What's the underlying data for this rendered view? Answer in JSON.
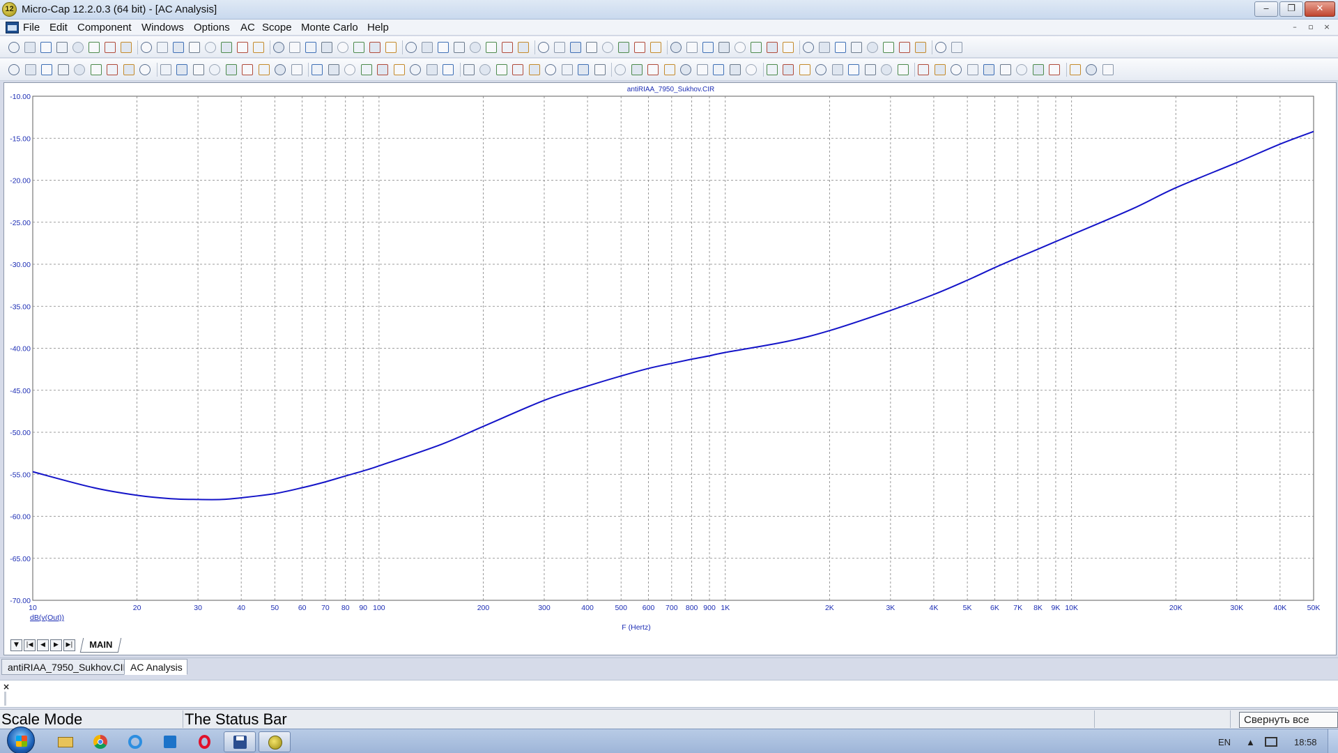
{
  "window": {
    "title": "Micro-Cap 12.2.0.3 (64 bit) - [AC Analysis]",
    "app_icon": "12",
    "buttons": [
      "minimize-icon",
      "restore-icon",
      "close-icon"
    ]
  },
  "menu": {
    "items": [
      "File",
      "Edit",
      "Component",
      "Windows",
      "Options",
      "AC",
      "Scope",
      "Monte Carlo",
      "Help"
    ]
  },
  "plot": {
    "title": "antiRIAA_7950_Sukhov.CIR",
    "ylabel": "dB(v(Out))",
    "xlabel": "F (Hertz)"
  },
  "chart_data": {
    "type": "line",
    "title": "antiRIAA_7950_Sukhov.CIR",
    "xlabel": "F (Hertz)",
    "ylabel": "dB(v(Out))",
    "xscale": "log",
    "xlim": [
      10,
      50000
    ],
    "ylim": [
      -70,
      -10
    ],
    "grid": true,
    "line_color": "#1414c8",
    "x_ticks": [
      "10",
      "20",
      "30",
      "40",
      "50",
      "60",
      "70",
      "80",
      "90",
      "100",
      "200",
      "300",
      "400",
      "500",
      "600",
      "700",
      "800",
      "900",
      "1K",
      "2K",
      "3K",
      "4K",
      "5K",
      "6K",
      "7K",
      "8K",
      "9K",
      "10K",
      "20K",
      "30K",
      "40K",
      "50K"
    ],
    "x_tick_values": [
      10,
      20,
      30,
      40,
      50,
      60,
      70,
      80,
      90,
      100,
      200,
      300,
      400,
      500,
      600,
      700,
      800,
      900,
      1000,
      2000,
      3000,
      4000,
      5000,
      6000,
      7000,
      8000,
      9000,
      10000,
      20000,
      30000,
      40000,
      50000
    ],
    "y_ticks": [
      "-10.00",
      "-15.00",
      "-20.00",
      "-25.00",
      "-30.00",
      "-35.00",
      "-40.00",
      "-45.00",
      "-50.00",
      "-55.00",
      "-60.00",
      "-65.00",
      "-70.00"
    ],
    "y_tick_values": [
      -10,
      -15,
      -20,
      -25,
      -30,
      -35,
      -40,
      -45,
      -50,
      -55,
      -60,
      -65,
      -70
    ],
    "series": [
      {
        "x": [
          10,
          15,
          20,
          25,
          30,
          35,
          40,
          50,
          60,
          70,
          80,
          90,
          100,
          150,
          200,
          300,
          400,
          500,
          600,
          700,
          800,
          900,
          1000,
          1500,
          2000,
          3000,
          4000,
          5000,
          6000,
          7000,
          8000,
          9000,
          10000,
          15000,
          20000,
          30000,
          40000,
          50000
        ],
        "y": [
          -54.7,
          -56.6,
          -57.5,
          -57.9,
          -58.0,
          -58.0,
          -57.8,
          -57.3,
          -56.6,
          -55.9,
          -55.2,
          -54.6,
          -54.0,
          -51.5,
          -49.3,
          -46.2,
          -44.5,
          -43.3,
          -42.4,
          -41.8,
          -41.3,
          -40.9,
          -40.5,
          -39.2,
          -37.9,
          -35.5,
          -33.6,
          -31.9,
          -30.4,
          -29.2,
          -28.2,
          -27.3,
          -26.5,
          -23.4,
          -20.9,
          -17.9,
          -15.7,
          -14.2
        ]
      }
    ]
  },
  "page_tabs": {
    "main": "MAIN",
    "nav": [
      "▼",
      "|◀",
      "◀",
      "▶",
      "▶|"
    ]
  },
  "doc_tabs": [
    "antiRIAA_7950_Sukhov.CIR",
    "AC Analysis"
  ],
  "output": {
    "close": "×"
  },
  "status": {
    "mode": "Scale Mode",
    "text": "The Status Bar",
    "show_desktop": "Свернуть все окна"
  },
  "taskbar": {
    "apps": [
      "explorer-icon",
      "chrome-icon",
      "ie-icon",
      "store-icon",
      "opera-icon",
      "floppy-icon",
      "microcap-icon"
    ],
    "lang": "EN",
    "time": "18:58"
  },
  "colors": {
    "plot_line": "#1414c8",
    "axis_text": "#1c2db4",
    "grid": "#7f7f7f"
  }
}
